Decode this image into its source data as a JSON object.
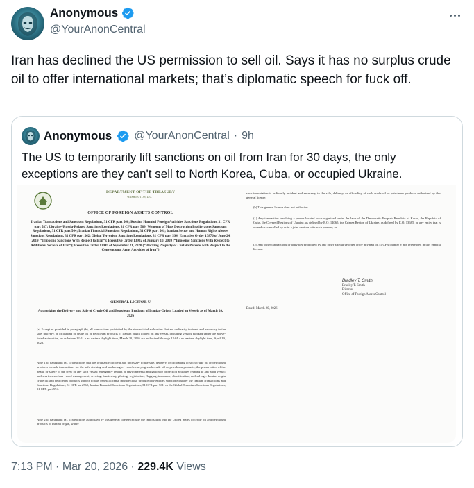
{
  "author": {
    "display_name": "Anonymous",
    "handle": "@YourAnonCentral",
    "avatar_icon": "anonymous-mask-icon",
    "verified_icon": "verified-badge-icon",
    "verified_color": "#1d9bf0"
  },
  "more_icon": "more-options-icon",
  "tweet_text": "Iran has declined the US permission to sell oil. Says it has no surplus crude oil to offer international markets; that’s diplomatic speech for fuck off.",
  "quote": {
    "display_name": "Anonymous",
    "handle": "@YourAnonCentral",
    "time": "9h",
    "text": "The US to temporarily lift sanctions on oil from Iran for 30 days, the only exceptions are they can't sell to North Korea, Cuba, or occupied Ukraine.",
    "document": {
      "department": "DEPARTMENT OF THE TREASURY",
      "city": "WASHINGTON, D.C.",
      "office": "OFFICE OF FOREIGN ASSETS CONTROL",
      "regulations": "Iranian Transactions and Sanctions Regulations, 31 CFR part 560; Russian Harmful Foreign Activities Sanctions Regulations, 31 CFR part 587; Ukraine-/Russia-Related Sanctions Regulations, 31 CFR part 589; Weapons of Mass Destruction Proliferators Sanctions Regulations, 31 CFR part 544; Iranian Financial Sanctions Regulations, 31 CFR part 561; Iranian Sector and Human Rights Abuses Sanctions Regulations, 31 CFR part 562; Global Terrorism Sanctions Regulations, 31 CFR part 594; Executive Order 13876 of June 24, 2019 (“Imposing Sanctions With Respect to Iran”); Executive Order 13902 of January 10, 2020 (“Imposing Sanctions With Respect to Additional Sectors of Iran”); Executive Order 13949 of September 21, 2020 (“Blocking Property of Certain Persons with Respect to the Conventional Arms Activities of Iran”)",
      "license_title": "GENERAL LICENSE U",
      "license_subtitle": "Authorizing the Delivery and Sale of Crude Oil and Petroleum Products of Iranian-Origin Loaded on Vessels as of March 20, 2026",
      "para_a": "(a) Except as provided in paragraph (b), all transactions prohibited by the above-listed authorities that are ordinarily incident and necessary to the sale, delivery, or offloading of crude oil or petroleum products of Iranian origin loaded on any vessel, including vessels blocked under the above-listed authorities, on or before 12:01 a.m. eastern daylight time, March 20, 2026 are authorized through 12:01 a.m. eastern daylight time, April 19, 2026.",
      "note_1": "Note 1 to paragraph (a). Transactions that are ordinarily incident and necessary to the sale, delivery, or offloading of such crude oil or petroleum products include transactions for the safe docking and anchoring of vessels carrying such crude oil or petroleum products; the preservation of the health or safety of the crew of any such vessel; emergency repairs or environmental mitigation or protection activities relating to any such vessel; and services such as vessel management, crewing, bunkering, piloting, registration, flagging, insurance, classification, and salvage. Iranian-origin crude oil and petroleum products subject to this general license include those produced by entities sanctioned under the Iranian Transactions and Sanctions Regulations, 31 CFR part 560, Iranian Financial Sanctions Regulations, 31 CFR part 561, or the Global Terrorism Sanctions Regulations, 31 CFR part 594.",
      "note_2": "Note 2 to paragraph (a). Transactions authorized by this general license include the importation into the United States of crude oil and petroleum products of Iranian origin, where",
      "right_cont": "such importation is ordinarily incident and necessary to the sale, delivery, or offloading of such crude oil or petroleum products authorized by this general license.",
      "para_b": "(b) This general license does not authorize:",
      "para_b1": "(1) Any transaction involving a person located in or organized under the laws of the Democratic People's Republic of Korea, the Republic of Cuba, the Covered Regions of Ukraine, as defined by E.O. 14065, the Crimea Region of Ukraine, as defined by E.O. 13685, or any entity that is owned or controlled by or in a joint venture with such persons; or",
      "para_b2": "(2) Any other transactions or activities prohibited by any other Executive order or by any part of 31 CFR chapter V not referenced in this general license.",
      "signature": "Bradley T. Smith",
      "signer_name": "Bradley T. Smith",
      "signer_title": "Director",
      "signer_office": "Office of Foreign Assets Control",
      "dated": "Dated: March 20, 2026"
    }
  },
  "footer": {
    "time": "7:13 PM",
    "sep1": " · ",
    "date": "Mar 20, 2026",
    "sep2": " · ",
    "views_count": "229.4K",
    "views_label": " Views"
  }
}
